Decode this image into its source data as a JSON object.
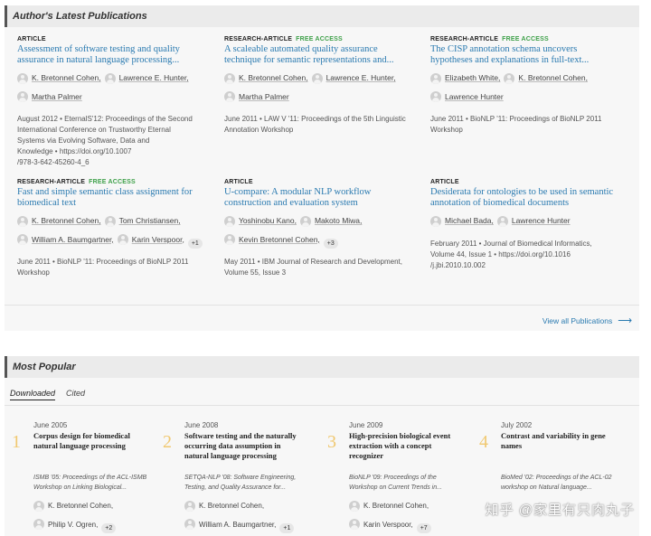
{
  "latest": {
    "title": "Author's Latest Publications",
    "view_all": "View all Publications",
    "items": [
      {
        "type": "ARTICLE",
        "free": "",
        "title_l1": "Assessment of software testing and quality",
        "title_l2": "assurance in natural language processing...",
        "authors": [
          "K. Bretonnel Cohen,",
          "Lawrence E. Hunter,",
          "Martha Palmer"
        ],
        "more": "",
        "meta": [
          "August 2012 • EternalS'12: Proceedings of the Second",
          "International Conference on Trustworthy Eternal",
          "Systems via Evolving Software, Data and",
          "Knowledge • https://doi.org/10.1007",
          "/978-3-642-45260-4_6"
        ]
      },
      {
        "type": "RESEARCH-ARTICLE",
        "free": "FREE ACCESS",
        "title_l1": "A scaleable automated quality assurance",
        "title_l2": "technique for semantic representations and...",
        "authors": [
          "K. Bretonnel Cohen,",
          "Lawrence E. Hunter,",
          "Martha Palmer"
        ],
        "more": "",
        "meta": [
          "June 2011 • LAW V '11: Proceedings of the 5th Linguistic",
          "Annotation Workshop"
        ]
      },
      {
        "type": "RESEARCH-ARTICLE",
        "free": "FREE ACCESS",
        "title_l1": "The CISP annotation schema uncovers",
        "title_l2": "hypotheses and explanations in full-text...",
        "authors": [
          "Elizabeth White,",
          "K. Bretonnel Cohen,",
          "Lawrence Hunter"
        ],
        "more": "",
        "meta": [
          "June 2011 • BioNLP '11: Proceedings of BioNLP 2011",
          "Workshop"
        ]
      },
      {
        "type": "RESEARCH-ARTICLE",
        "free": "FREE ACCESS",
        "title_l1": "Fast and simple semantic class assignment for",
        "title_l2": "biomedical text",
        "authors": [
          "K. Bretonnel Cohen,",
          "Tom Christiansen,",
          "William A. Baumgartner,",
          "Karin Verspoor,"
        ],
        "more": "+1",
        "meta": [
          "June 2011 • BioNLP '11: Proceedings of BioNLP 2011",
          "Workshop"
        ]
      },
      {
        "type": "ARTICLE",
        "free": "",
        "title_l1": "U-compare: A modular NLP workflow",
        "title_l2": "construction and evaluation system",
        "authors": [
          "Yoshinobu Kano,",
          "Makoto Miwa,",
          "Kevin Bretonnel Cohen,"
        ],
        "more": "+3",
        "meta": [
          "May 2011 • IBM Journal of Research and Development,",
          "Volume 55, Issue 3"
        ]
      },
      {
        "type": "ARTICLE",
        "free": "",
        "title_l1": "Desiderata for ontologies to be used in semantic",
        "title_l2": "annotation of biomedical documents",
        "authors": [
          "Michael Bada,",
          "Lawrence Hunter"
        ],
        "more": "",
        "meta": [
          "February 2011 • Journal of Biomedical Informatics,",
          "Volume 44, Issue 1 • https://doi.org/10.1016",
          "/j.jbi.2010.10.002"
        ]
      }
    ]
  },
  "popular": {
    "title": "Most Popular",
    "tabs": [
      "Downloaded",
      "Cited"
    ],
    "items": [
      {
        "num": "1",
        "date": "June 2005",
        "title": [
          "Corpus design for biomedical",
          "natural language processing"
        ],
        "venue": [
          "ISMB '05: Proceedings of the ACL-ISMB",
          "Workshop on Linking Biological..."
        ],
        "authors": [
          "K. Bretonnel Cohen,",
          "Philip V. Ogren,"
        ],
        "more": "+2"
      },
      {
        "num": "2",
        "date": "June 2008",
        "title": [
          "Software testing and the naturally",
          "occurring data assumption in",
          "natural language processing"
        ],
        "venue": [
          "SETQA-NLP '08: Software Engineering,",
          "Testing, and Quality Assurance for..."
        ],
        "authors": [
          "K. Bretonnel Cohen,",
          "William A. Baumgartner,"
        ],
        "more": "+1"
      },
      {
        "num": "3",
        "date": "June 2009",
        "title": [
          "High-precision biological event",
          "extraction with a concept",
          "recognizer"
        ],
        "venue": [
          "BioNLP '09: Proceedings of the",
          "Workshop on Current Trends in..."
        ],
        "authors": [
          "K. Bretonnel Cohen,",
          "Karin Verspoor,"
        ],
        "more": "+7"
      },
      {
        "num": "4",
        "date": "July 2002",
        "title": [
          "Contrast and variability in gene",
          "names"
        ],
        "venue": [
          "BioMed '02: Proceedings of the ACL-02",
          "workshop on Natural language..."
        ],
        "authors": [],
        "more": ""
      }
    ]
  },
  "watermark": "知乎 @家里有只肉丸子"
}
